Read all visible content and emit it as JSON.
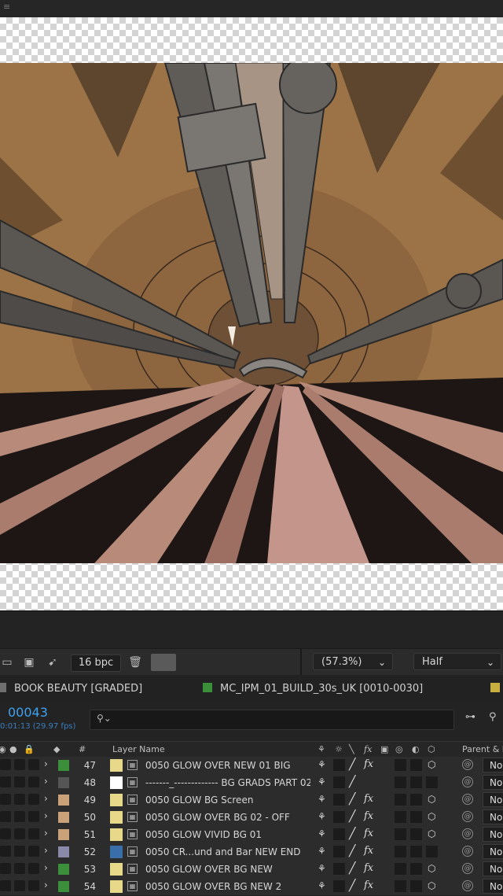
{
  "toolbar": {
    "bpc_label": "16 bpc",
    "zoom_label": "(57.3%)",
    "resolution_label": "Half"
  },
  "tabs": [
    {
      "label": "BOOK BEAUTY [GRADED]",
      "color": "#6f6f6f"
    },
    {
      "label": "MC_IPM_01_BUILD_30s_UK [0010-0030]",
      "color": "#3b8f3b"
    }
  ],
  "timeline": {
    "timecode": "00043",
    "fps_text": "0:01:13 (29.97 fps)",
    "search_placeholder": ""
  },
  "columns": {
    "num": "#",
    "layer_name": "Layer Name",
    "parent": "Parent & L"
  },
  "icons": {
    "switch": "shy-switch-icon",
    "slash": "quality-slash-icon",
    "fx": "fx-icon",
    "cube": "3d-layer-icon",
    "pickwhip": "pickwhip-icon"
  },
  "layers": [
    {
      "num": "47",
      "name": "0050 GLOW  OVER NEW 01 BIG",
      "label_color": "#3b8f3b",
      "src_color": "#e8d98a",
      "fx": true,
      "cube": true,
      "parent": "No"
    },
    {
      "num": "48",
      "name": "-------_------------- BG GRADS PART 02",
      "label_color": "#555555",
      "src_color": "#ffffff",
      "fx": false,
      "cube": false,
      "parent": "No"
    },
    {
      "num": "49",
      "name": "0050 GLOW  BG Screen",
      "label_color": "#c9a27a",
      "src_color": "#e8d98a",
      "fx": true,
      "cube": true,
      "parent": "No"
    },
    {
      "num": "50",
      "name": "0050 GLOW OVER  BG 02 - OFF",
      "label_color": "#c9a27a",
      "src_color": "#e8d98a",
      "fx": true,
      "cube": true,
      "parent": "No"
    },
    {
      "num": "51",
      "name": "0050 GLOW VIVID BG 01",
      "label_color": "#c9a27a",
      "src_color": "#e8d98a",
      "fx": true,
      "cube": true,
      "parent": "No"
    },
    {
      "num": "52",
      "name": "0050 CR...und and Bar NEW END",
      "label_color": "#8a8aa8",
      "src_color": "#3a6ea8",
      "fx": true,
      "cube": false,
      "parent": "No"
    },
    {
      "num": "53",
      "name": "0050 GLOW OVER  BG NEW",
      "label_color": "#3b8f3b",
      "src_color": "#e8d98a",
      "fx": true,
      "cube": true,
      "parent": "No"
    },
    {
      "num": "54",
      "name": "0050 GLOW OVER  BG NEW 2",
      "label_color": "#3b8f3b",
      "src_color": "#e8d98a",
      "fx": true,
      "cube": true,
      "parent": "No"
    }
  ]
}
